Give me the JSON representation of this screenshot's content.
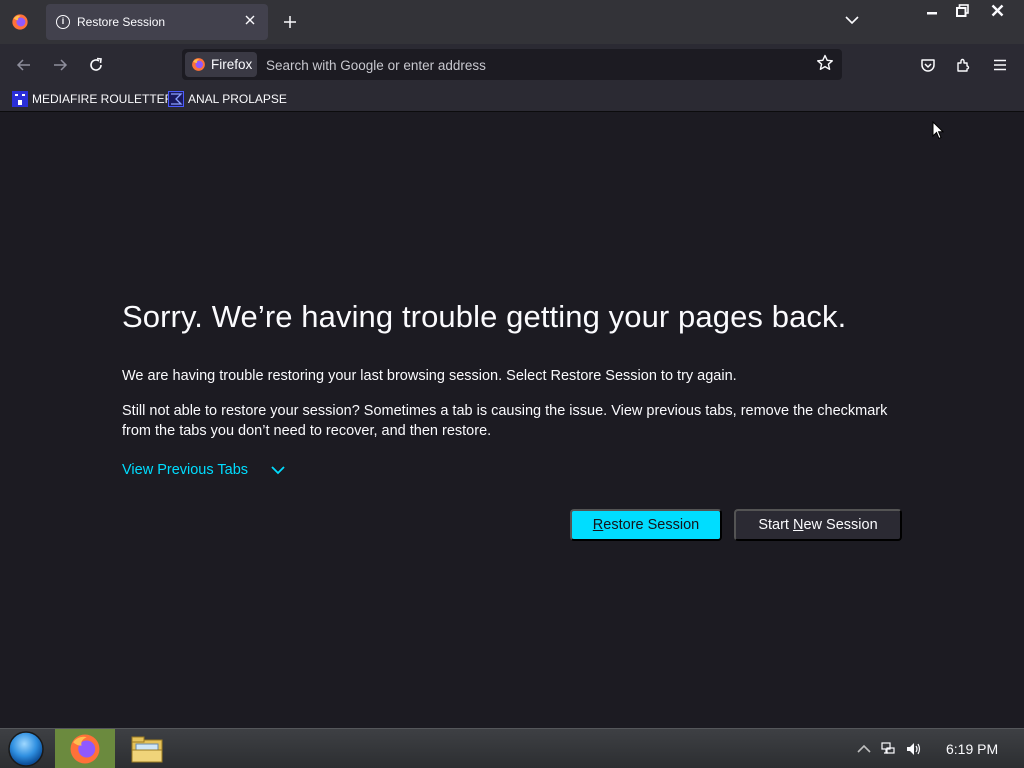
{
  "tab": {
    "title": "Restore Session"
  },
  "urlbar": {
    "identity_label": "Firefox",
    "placeholder": "Search with Google or enter address"
  },
  "bookmarks": [
    {
      "label": "MEDIAFIRE ROULETTER"
    },
    {
      "label": "ANAL PROLAPSE"
    }
  ],
  "content": {
    "title": "Sorry. We’re having trouble getting your pages back.",
    "p1": "We are having trouble restoring your last browsing session. Select Restore Session to try again.",
    "p2": "Still not able to restore your session? Sometimes a tab is causing the issue. View previous tabs, remove the checkmark from the tabs you don’t need to recover, and then restore.",
    "view_previous": "View Previous Tabs",
    "restore_btn": {
      "accel": "R",
      "rest": "estore Session"
    },
    "new_btn": {
      "pre": "Start ",
      "accel": "N",
      "rest": "ew Session"
    }
  },
  "taskbar": {
    "clock": "6:19 PM"
  },
  "colors": {
    "accent": "#00ddff",
    "page_bg": "#1c1b22",
    "toolbar": "#2b2a33",
    "tabstrip": "#333338"
  },
  "icons": [
    "firefox-icon",
    "info-icon",
    "close-icon",
    "plus-icon",
    "chevron-down-icon",
    "minimize-icon",
    "restore-icon",
    "back-icon",
    "forward-icon",
    "reload-icon",
    "star-icon",
    "pocket-icon",
    "extensions-icon",
    "menu-icon",
    "start-orb-icon",
    "folder-icon",
    "network-icon",
    "volume-icon"
  ]
}
